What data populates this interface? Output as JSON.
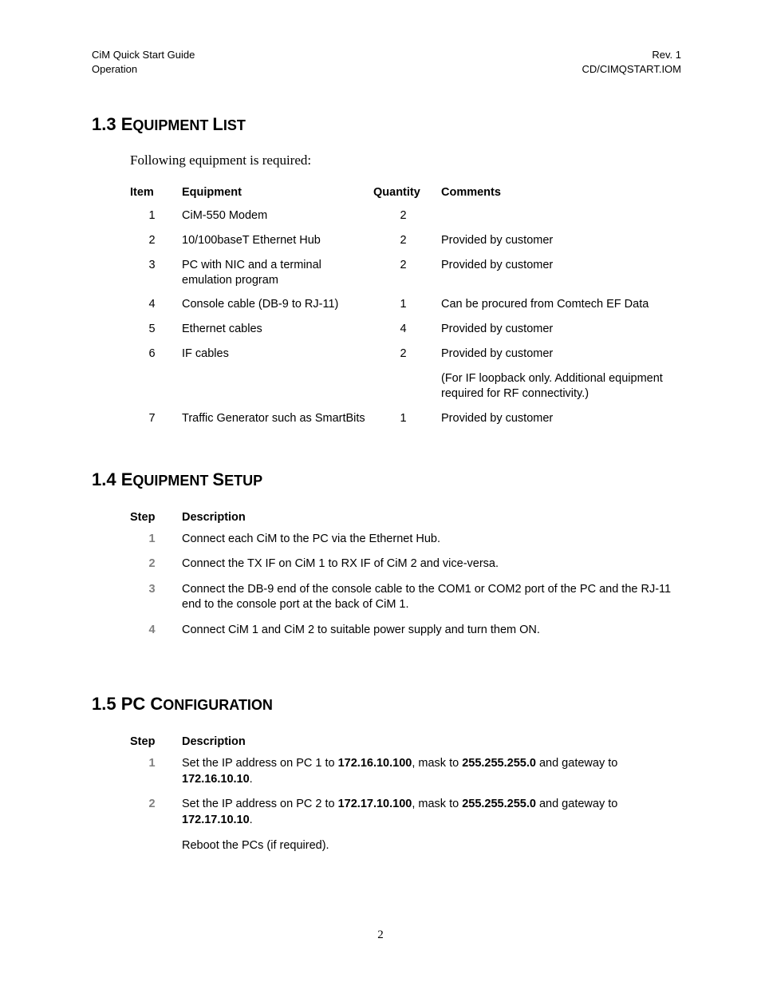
{
  "header": {
    "left_line1": "CiM Quick Start Guide",
    "left_line2": "Operation",
    "right_line1": "Rev. 1",
    "right_line2": "CD/CIMQSTART.IOM"
  },
  "sec13": {
    "num": "1.3 ",
    "first": "E",
    "rest1": "QUIPMENT ",
    "first2": "L",
    "rest2": "IST",
    "intro": "Following equipment is required:",
    "cols": {
      "item": "Item",
      "equip": "Equipment",
      "qty": "Quantity",
      "comm": "Comments"
    },
    "rows": [
      {
        "item": "1",
        "equip": "CiM-550 Modem",
        "qty": "2",
        "comm": ""
      },
      {
        "item": "2",
        "equip": "10/100baseT Ethernet Hub",
        "qty": "2",
        "comm": "Provided by customer"
      },
      {
        "item": "3",
        "equip": "PC with NIC and a terminal emulation program",
        "qty": "2",
        "comm": "Provided by customer"
      },
      {
        "item": "4",
        "equip": "Console cable (DB-9 to RJ-11)",
        "qty": "1",
        "comm": "Can be procured from Comtech EF Data"
      },
      {
        "item": "5",
        "equip": "Ethernet cables",
        "qty": "4",
        "comm": "Provided by customer"
      },
      {
        "item": "6",
        "equip": "IF cables",
        "qty": "2",
        "comm": "Provided by customer"
      },
      {
        "item": "",
        "equip": "",
        "qty": "",
        "comm": "(For IF loopback only. Additional equipment required for RF connectivity.)"
      },
      {
        "item": "7",
        "equip": "Traffic Generator such as SmartBits",
        "qty": "1",
        "comm": "Provided by customer"
      }
    ]
  },
  "sec14": {
    "num": "1.4 ",
    "first": "E",
    "rest1": "QUIPMENT ",
    "first2": "S",
    "rest2": "ETUP",
    "cols": {
      "step": "Step",
      "desc": "Description"
    },
    "rows": [
      {
        "step": "1",
        "desc": "Connect each CiM to the PC via the Ethernet Hub."
      },
      {
        "step": "2",
        "desc": "Connect the TX IF on CiM 1 to RX IF of CiM 2 and vice-versa."
      },
      {
        "step": "3",
        "desc": "Connect the DB-9 end of the console cable to the COM1 or COM2 port of the PC and the RJ-11 end to the console port at the back of CiM 1."
      },
      {
        "step": "4",
        "desc": "Connect CiM 1 and CiM 2 to suitable power supply and turn them ON."
      }
    ]
  },
  "sec15": {
    "num": "1.5 ",
    "first": "PC ",
    "first2": "C",
    "rest2": "ONFIGURATION",
    "cols": {
      "step": "Step",
      "desc": "Description"
    },
    "rows": [
      {
        "step": "1",
        "pre": "Set the IP address on PC 1 to ",
        "b1": "172.16.10.100",
        "mid1": ", mask to ",
        "b2": "255.255.255.0",
        "mid2": " and gateway to ",
        "b3": "172.16.10.10",
        "post": "."
      },
      {
        "step": "2",
        "pre": "Set the IP address on PC 2 to ",
        "b1": "172.17.10.100",
        "mid1": ", mask to ",
        "b2": "255.255.255.0",
        "mid2": " and gateway to ",
        "b3": "172.17.10.10",
        "post": "."
      }
    ],
    "tail": "Reboot the PCs (if required)."
  },
  "footer": {
    "page": "2"
  }
}
